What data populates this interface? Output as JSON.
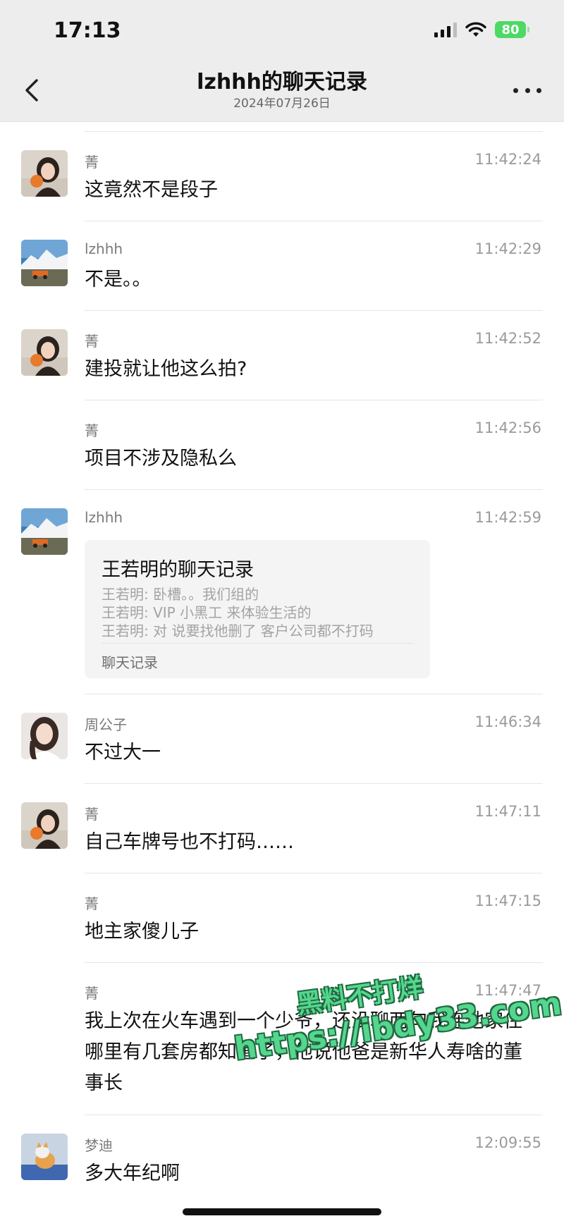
{
  "status_bar": {
    "time": "17:13",
    "battery": "80"
  },
  "header": {
    "title": "lzhhh的聊天记录",
    "date": "2024年07月26日",
    "back_icon": "chevron-left-icon",
    "more_icon": "more-icon"
  },
  "messages": [
    {
      "sender": "菁",
      "time": "11:42:24",
      "text": "这竟然不是段子"
    },
    {
      "sender": "lzhhh",
      "time": "11:42:29",
      "text": "不是。。"
    },
    {
      "sender": "菁",
      "time": "11:42:52",
      "text": "建投就让他这么拍?"
    },
    {
      "sender": "菁",
      "time": "11:42:56",
      "text": "项目不涉及隐私么"
    },
    {
      "sender": "lzhhh",
      "time": "11:42:59",
      "card": {
        "title": "王若明的聊天记录",
        "lines": [
          "王若明: 卧槽。。我们组的",
          "王若明: VIP 小黑工 来体验生活的",
          "王若明: 对 说要找他删了 客户公司都不打码"
        ],
        "footer": "聊天记录"
      }
    },
    {
      "sender": "周公子",
      "time": "11:46:34",
      "text": "不过大一"
    },
    {
      "sender": "菁",
      "time": "11:47:11",
      "text": "自己车牌号也不打码……"
    },
    {
      "sender": "菁",
      "time": "11:47:15",
      "text": "地主家傻儿子"
    },
    {
      "sender": "菁",
      "time": "11:47:47",
      "text": "我上次在火车遇到一个少爷，还没聊两句我连他家住哪里有几套房都知道了，他说他爸是新华人寿啥的董事长"
    },
    {
      "sender": "梦迪",
      "time": "12:09:55",
      "text": "多大年纪啊"
    }
  ],
  "watermark": {
    "line1": "黑料不打烊",
    "line2": "https://ibdy33.com"
  },
  "colors": {
    "header_bg": "#ededed",
    "battery": "#4cd964",
    "watermark": "#55d68e"
  }
}
